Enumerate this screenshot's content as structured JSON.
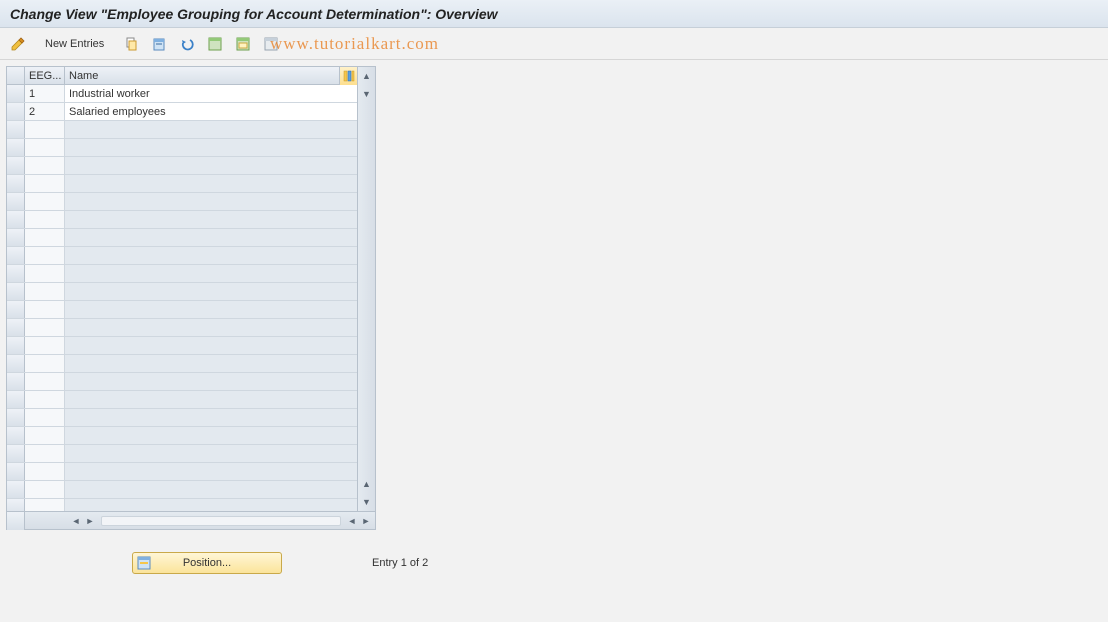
{
  "title": "Change View \"Employee Grouping for Account Determination\": Overview",
  "toolbar": {
    "new_entries": "New Entries"
  },
  "watermark": "www.tutorialkart.com",
  "table": {
    "columns": {
      "eeg": "EEG...",
      "name": "Name"
    },
    "rows": [
      {
        "eeg": "1",
        "name": "Industrial worker"
      },
      {
        "eeg": "2",
        "name": "Salaried employees"
      }
    ],
    "empty_row_count": 22
  },
  "footer": {
    "position_label": "Position...",
    "entry_text": "Entry 1 of 2"
  }
}
